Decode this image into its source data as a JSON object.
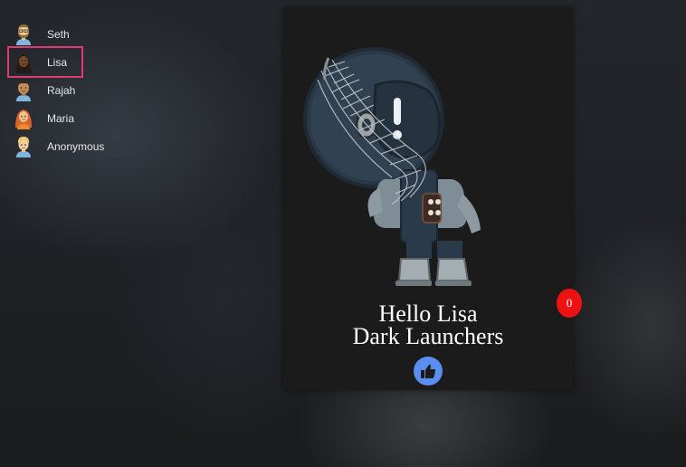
{
  "contacts": [
    {
      "name": "Seth",
      "avatar": "man-with-beard-avatar-icon",
      "selected": false
    },
    {
      "name": "Lisa",
      "avatar": "woman-dark-hair-avatar-icon",
      "selected": true
    },
    {
      "name": "Rajah",
      "avatar": "man-brown-hair-avatar-icon",
      "selected": false
    },
    {
      "name": "Maria",
      "avatar": "woman-red-hair-avatar-icon",
      "selected": false
    },
    {
      "name": "Anonymous",
      "avatar": "blond-person-avatar-icon",
      "selected": false
    }
  ],
  "card": {
    "illustration": "astronaut-in-net-illustration",
    "greeting_line1": "Hello Lisa",
    "greeting_line2": "Dark Launchers",
    "like_icon": "thumbs-up-icon"
  },
  "counter": {
    "value": "0"
  },
  "colors": {
    "selection_outline": "#e0396e",
    "like_button": "#5b8ef0",
    "counter_badge": "#ee1111",
    "card_background": "#1b1b1b"
  }
}
